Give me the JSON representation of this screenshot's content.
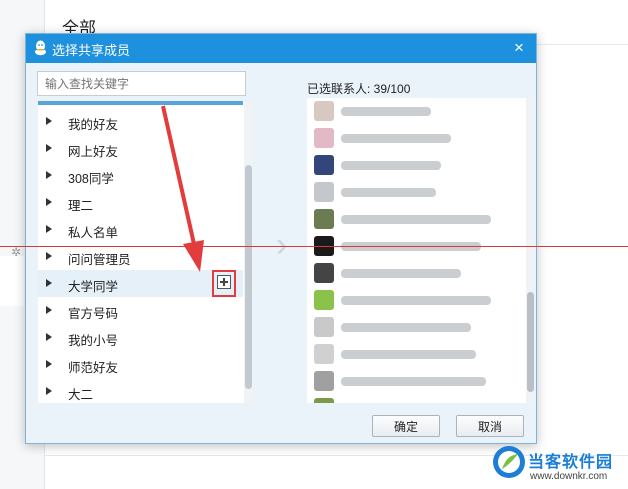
{
  "background": {
    "title": "全部"
  },
  "dialog": {
    "title": "选择共享成员",
    "close_glyph": "×",
    "search_placeholder": "输入查找关键字",
    "groups": [
      {
        "label": "我的好友"
      },
      {
        "label": "网上好友"
      },
      {
        "label": "308同学"
      },
      {
        "label": "理二"
      },
      {
        "label": "私人名单"
      },
      {
        "label": "问问管理员"
      },
      {
        "label": "大学同学"
      },
      {
        "label": "官方号码"
      },
      {
        "label": "我的小号"
      },
      {
        "label": "师范好友"
      },
      {
        "label": "大二"
      }
    ],
    "selected_count_label": "已选联系人: 39/100",
    "ok_label": "确定",
    "cancel_label": "取消"
  },
  "watermark": {
    "title": "当客软件园",
    "url": "www.downkr.com"
  },
  "colors": {
    "titlebar": "#1d91dd",
    "annotation": "#e23c3c",
    "brand": "#1c7ed6"
  },
  "icons": {
    "app": "qq-penguin-icon",
    "expand": "triangle-right-icon",
    "add": "plus-square-icon"
  }
}
